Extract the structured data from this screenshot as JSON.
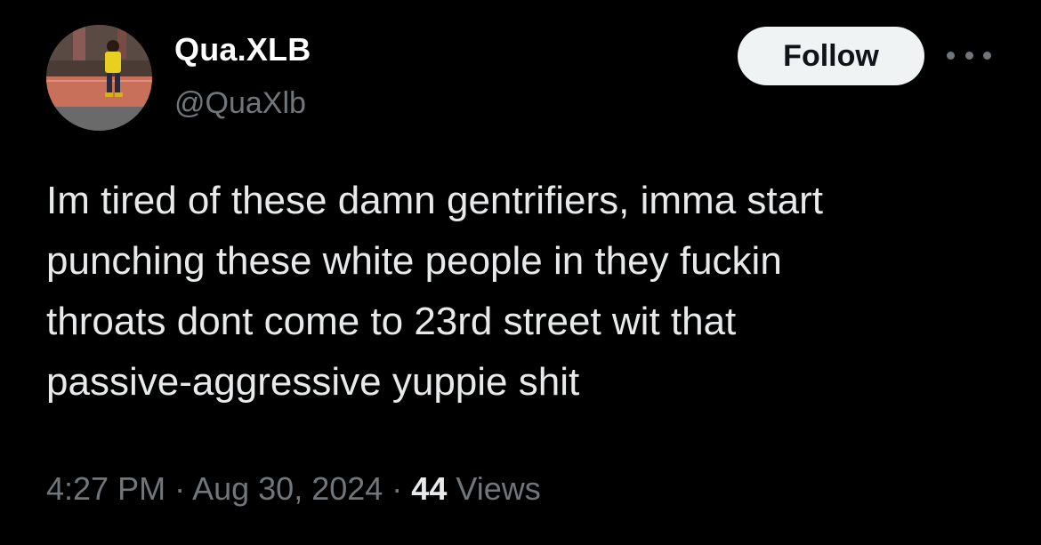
{
  "user": {
    "display_name": "Qua.XLB",
    "handle": "@QuaXlb"
  },
  "follow_button": {
    "label": "Follow"
  },
  "more_menu": {
    "icon": "more-horizontal-icon"
  },
  "tweet": {
    "text": "Im tired of these damn gentrifiers, imma start\npunching these white people in they fuckin\nthroats dont come to 23rd street wit that\npassive-aggressive yuppie shit"
  },
  "meta": {
    "time": "4:27 PM",
    "separator": " · ",
    "date": "Aug 30, 2024",
    "views_count": "44",
    "views_label": " Views"
  },
  "colors": {
    "background": "#000000",
    "primary_text": "#e7e9ea",
    "secondary_text": "#71767b",
    "follow_bg": "#eff3f4",
    "follow_text": "#0f1419"
  }
}
